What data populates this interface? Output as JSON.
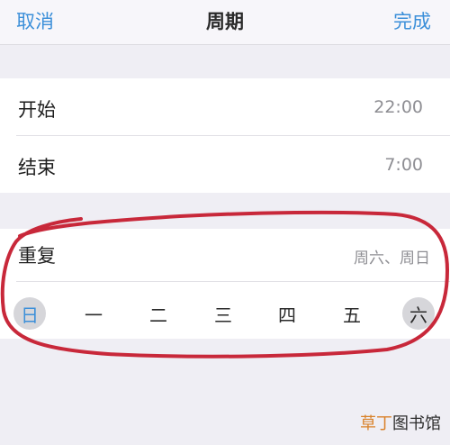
{
  "navbar": {
    "cancel_label": "取消",
    "title": "周期",
    "done_label": "完成"
  },
  "schedule": {
    "start_label": "开始",
    "start_value": "22:00",
    "end_label": "结束",
    "end_value": "7:00"
  },
  "repeat": {
    "label": "重复",
    "value": "周六、周日",
    "days": [
      {
        "label": "日",
        "selected": true
      },
      {
        "label": "一",
        "selected": false
      },
      {
        "label": "二",
        "selected": false
      },
      {
        "label": "三",
        "selected": false
      },
      {
        "label": "四",
        "selected": false
      },
      {
        "label": "五",
        "selected": false
      },
      {
        "label": "六",
        "selected": true
      }
    ]
  },
  "annotation": {
    "color": "#c8283a"
  },
  "watermark": {
    "accent": "草丁",
    "rest": "图书馆"
  },
  "colors": {
    "accent": "#3b8fd9",
    "background": "#efeef4"
  }
}
